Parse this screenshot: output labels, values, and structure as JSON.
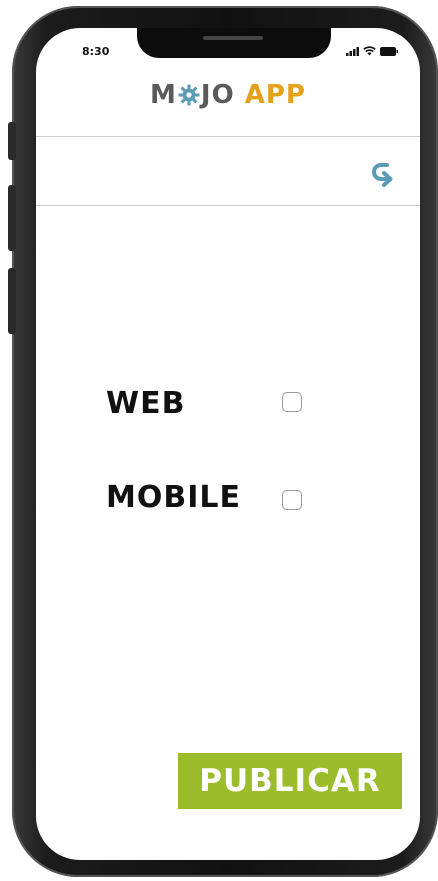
{
  "status_bar": {
    "time": "8:30"
  },
  "header": {
    "logo_mojo_left": "M",
    "logo_mojo_right": "JO",
    "logo_app": "APP"
  },
  "options": [
    {
      "label": "WEB",
      "checked": false
    },
    {
      "label": "MOBILE",
      "checked": false
    }
  ],
  "actions": {
    "publish_label": "PUBLICAR"
  },
  "colors": {
    "accent_green": "#9bbd2c",
    "logo_orange": "#e6a019",
    "back_arrow": "#5b9bb5"
  },
  "icons": {
    "back": "back-arrow-icon",
    "gear": "gear-icon"
  }
}
